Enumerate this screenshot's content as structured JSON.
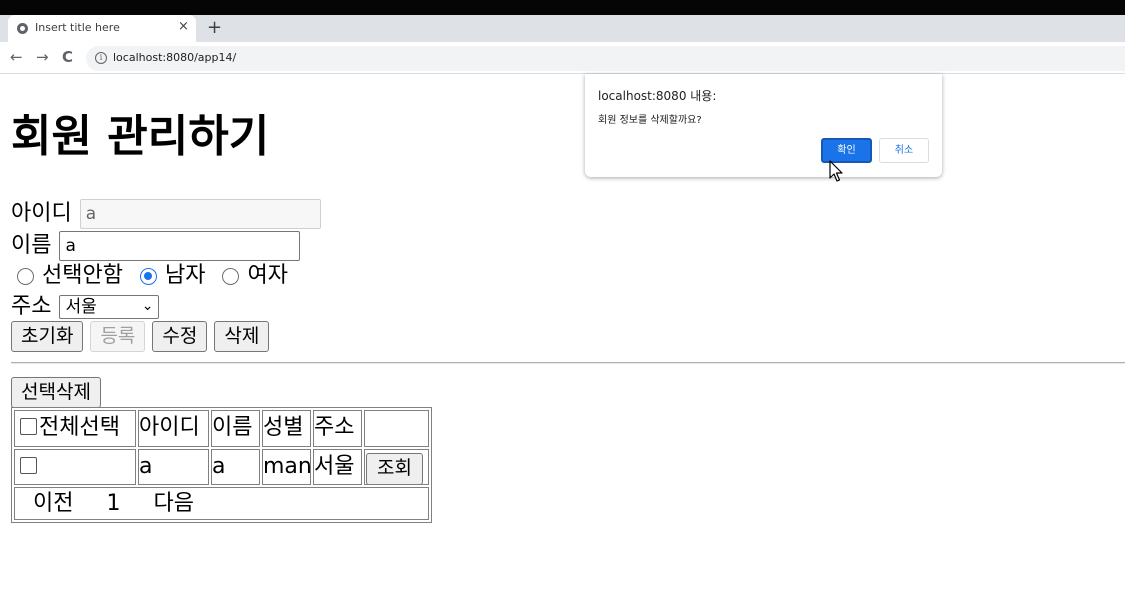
{
  "browser": {
    "tab_title": "Insert title here",
    "tab_close": "×",
    "new_tab": "+",
    "back": "←",
    "forward": "→",
    "reload": "C",
    "info": "i",
    "url": "localhost:8080/app14/"
  },
  "page": {
    "title": "회원 관리하기",
    "form": {
      "id_label": "아이디",
      "id_value": "a",
      "name_label": "이름",
      "name_value": "a",
      "gender_options": [
        "선택안함",
        "남자",
        "여자"
      ],
      "gender_selected": "남자",
      "address_label": "주소",
      "address_selected": "서울",
      "select_arrow": "⌄"
    },
    "buttons": {
      "reset": "초기화",
      "register": "등록",
      "update": "수정",
      "delete": "삭제"
    },
    "select_delete": "선택삭제",
    "table": {
      "headers": [
        "전체선택",
        "아이디",
        "이름",
        "성별",
        "주소",
        ""
      ],
      "rows": [
        {
          "id": "a",
          "name": "a",
          "gender": "man",
          "address": "서울",
          "action": "조회"
        }
      ],
      "pagination": {
        "prev": "이전",
        "page": "1",
        "next": "다음"
      }
    }
  },
  "dialog": {
    "title": "localhost:8080 내용:",
    "message": "회원 정보를 삭제할까요?",
    "ok": "확인",
    "cancel": "취소"
  },
  "colors": {
    "accent": "#1a73e8",
    "tabstrip": "#dee1e6",
    "topbar": "#050505"
  }
}
